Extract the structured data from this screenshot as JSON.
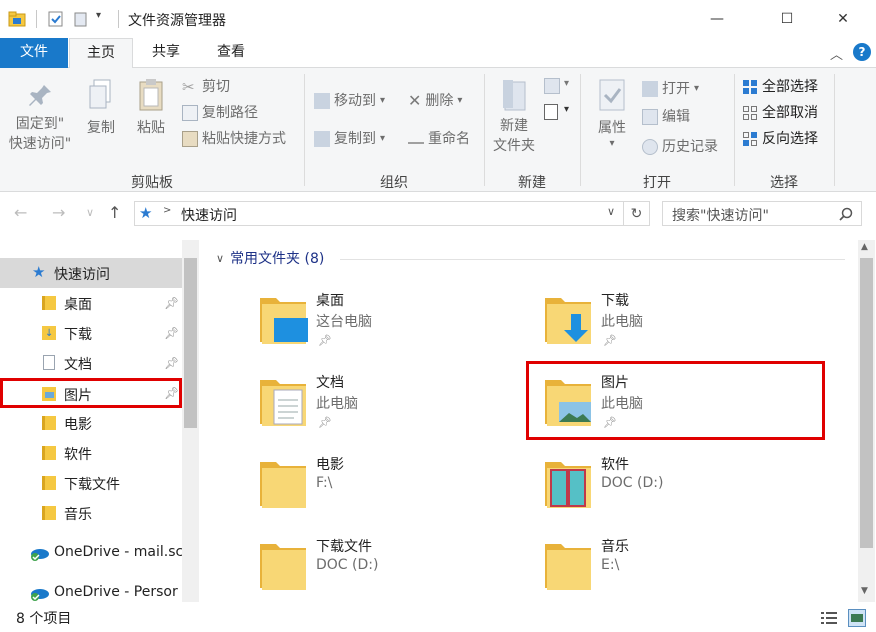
{
  "window": {
    "title": "文件资源管理器",
    "controls": {
      "minimize": "—",
      "maximize": "☐",
      "close": "✕"
    }
  },
  "tabs": [
    {
      "label": "文件"
    },
    {
      "label": "主页"
    },
    {
      "label": "共享"
    },
    {
      "label": "查看"
    }
  ],
  "ribbon": {
    "clipboard": {
      "pin_label_1": "固定到\"",
      "pin_label_2": "快速访问\"",
      "copy": "复制",
      "paste": "粘贴",
      "cut": "剪切",
      "copy_path": "复制路径",
      "paste_shortcut": "粘贴快捷方式",
      "group": "剪贴板"
    },
    "organize": {
      "move_to": "移动到",
      "copy_to": "复制到",
      "delete": "删除",
      "rename": "重命名",
      "group": "组织"
    },
    "new": {
      "new_folder_1": "新建",
      "new_folder_2": "文件夹",
      "group": "新建"
    },
    "open": {
      "properties": "属性",
      "open": "打开",
      "edit": "编辑",
      "history": "历史记录",
      "group": "打开"
    },
    "select": {
      "select_all": "全部选择",
      "select_none": "全部取消",
      "invert": "反向选择",
      "group": "选择"
    }
  },
  "address": {
    "path": "快速访问",
    "search_placeholder": "搜索\"快速访问\""
  },
  "nav": {
    "quick_access": "快速访问",
    "items": [
      {
        "label": "桌面"
      },
      {
        "label": "下载"
      },
      {
        "label": "文档"
      },
      {
        "label": "图片"
      },
      {
        "label": "电影"
      },
      {
        "label": "软件"
      },
      {
        "label": "下载文件"
      },
      {
        "label": "音乐"
      }
    ],
    "onedrive_1": "OneDrive - mail.sc",
    "onedrive_2": "OneDrive - Persor"
  },
  "content": {
    "group_header": "常用文件夹 (8)",
    "folders": [
      {
        "name": "桌面",
        "location": "这台电脑"
      },
      {
        "name": "下载",
        "location": "此电脑"
      },
      {
        "name": "文档",
        "location": "此电脑"
      },
      {
        "name": "图片",
        "location": "此电脑"
      },
      {
        "name": "电影",
        "location": "F:\\"
      },
      {
        "name": "软件",
        "location": "DOC (D:)"
      },
      {
        "name": "下载文件",
        "location": "DOC (D:)"
      },
      {
        "name": "音乐",
        "location": "E:\\"
      }
    ]
  },
  "status": {
    "item_count": "8 个项目"
  },
  "colors": {
    "file_tab": "#1979ca",
    "highlight": "#e00000",
    "folder": "#f5c842",
    "selected_nav": "#d9d9d9"
  }
}
